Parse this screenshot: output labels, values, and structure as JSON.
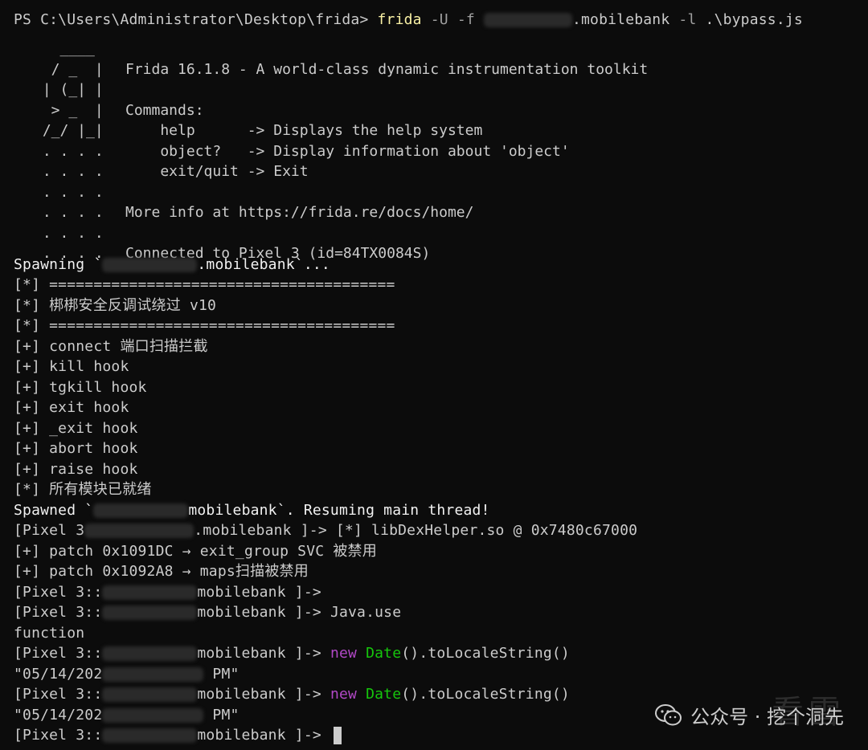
{
  "prompt": {
    "ps": "PS C:\\Users\\Administrator\\Desktop\\frida> ",
    "cmd": "frida",
    "args1": " -U -f ",
    "package_tail": ".mobilebank",
    "args2": " -l ",
    "script": ".\\bypass.js"
  },
  "banner": {
    "art": [
      "   ____",
      "  / _  |",
      " | (_| |",
      "  > _  |",
      " /_/ |_|",
      " . . . .",
      " . . . .",
      " . . . .",
      " . . . .",
      " . . . .",
      " . . . ."
    ],
    "lines": [
      "",
      "Frida 16.1.8 - A world-class dynamic instrumentation toolkit",
      "",
      "Commands:",
      "    help      -> Displays the help system",
      "    object?   -> Display information about 'object'",
      "    exit/quit -> Exit",
      "",
      "More info at https://frida.re/docs/home/",
      "",
      "Connected to Pixel 3 (id=84TX0084S)"
    ]
  },
  "output": {
    "spawning_prefix": "Spawning `",
    "spawning_suffix": ".mobilebank`...",
    "l1": "[*] =======================================",
    "l2": "[*] 梆梆安全反调试绕过 v10",
    "l3": "[*] =======================================",
    "l4": "[+] connect 端口扫描拦截",
    "l5": "[+] kill hook",
    "l6": "[+] tgkill hook",
    "l7": "[+] exit hook",
    "l8": "[+] _exit hook",
    "l9": "[+] abort hook",
    "l10": "[+] raise hook",
    "l11": "[*] 所有模块已就绪",
    "spawned_prefix": "Spawned `",
    "spawned_suffix": "mobilebank`. Resuming main thread!",
    "p1_prefix": "[Pixel 3",
    "p1_suffix": ".mobilebank ]-> [*] libDexHelper.so @ 0x7480c67000",
    "patch1": "[+] patch 0x1091DC → exit_group SVC 被禁用",
    "patch2": "[+] patch 0x1092A8 → maps扫描被禁用",
    "p2_prefix": "[Pixel 3::",
    "p2_suffix": "mobilebank ]->",
    "p3_prefix": "[Pixel 3::",
    "p3_suffix": "mobilebank ]-> ",
    "p3_cmd": "Java.use",
    "function_out": "function",
    "p4_prefix": "[Pixel 3::",
    "p4_suffix": "mobilebank ]-> ",
    "kw_new": "new",
    "cls_date": "Date",
    "tail_call": "().toLocaleString()",
    "res1_prefix": "\"05/14/202",
    "res1_suffix": " PM\"",
    "p5_prefix": "[Pixel 3::",
    "p5_suffix": "mobilebank ]-> ",
    "res2_prefix": "\"05/14/202",
    "res2_suffix": " PM\"",
    "p6_prefix": "[Pixel 3::",
    "p6_suffix": "mobilebank ]-> "
  },
  "watermark": {
    "text": "公众号 · 挖个洞先",
    "ghost": "看雪"
  },
  "colors": {
    "background": "#0c0c0c",
    "foreground": "#cccccc",
    "command": "#f9f1a5",
    "keyword": "#b148c6",
    "class": "#16c60c"
  }
}
